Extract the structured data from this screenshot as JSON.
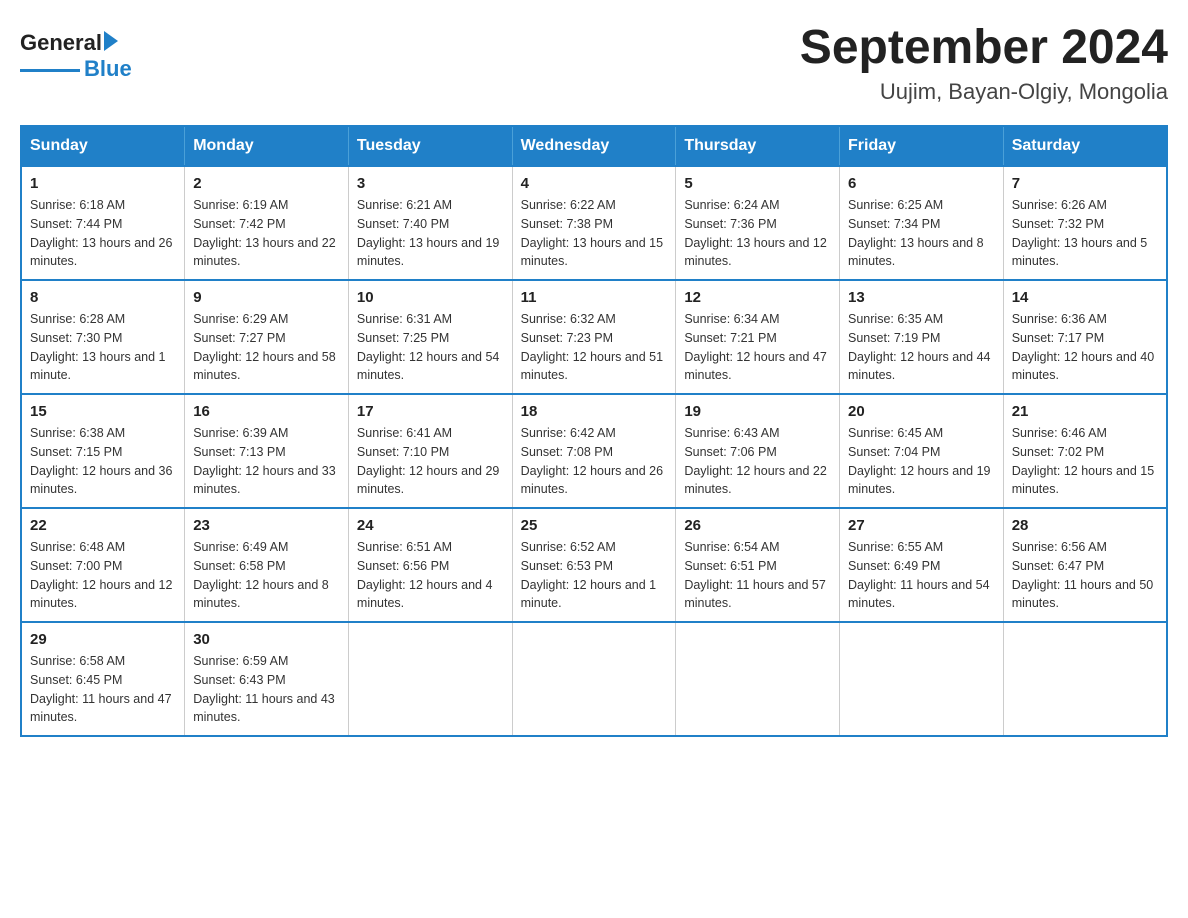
{
  "logo": {
    "general": "General",
    "blue": "Blue"
  },
  "header": {
    "title": "September 2024",
    "subtitle": "Uujim, Bayan-Olgiy, Mongolia"
  },
  "days_of_week": [
    "Sunday",
    "Monday",
    "Tuesday",
    "Wednesday",
    "Thursday",
    "Friday",
    "Saturday"
  ],
  "weeks": [
    [
      {
        "day": "1",
        "sunrise": "6:18 AM",
        "sunset": "7:44 PM",
        "daylight": "13 hours and 26 minutes."
      },
      {
        "day": "2",
        "sunrise": "6:19 AM",
        "sunset": "7:42 PM",
        "daylight": "13 hours and 22 minutes."
      },
      {
        "day": "3",
        "sunrise": "6:21 AM",
        "sunset": "7:40 PM",
        "daylight": "13 hours and 19 minutes."
      },
      {
        "day": "4",
        "sunrise": "6:22 AM",
        "sunset": "7:38 PM",
        "daylight": "13 hours and 15 minutes."
      },
      {
        "day": "5",
        "sunrise": "6:24 AM",
        "sunset": "7:36 PM",
        "daylight": "13 hours and 12 minutes."
      },
      {
        "day": "6",
        "sunrise": "6:25 AM",
        "sunset": "7:34 PM",
        "daylight": "13 hours and 8 minutes."
      },
      {
        "day": "7",
        "sunrise": "6:26 AM",
        "sunset": "7:32 PM",
        "daylight": "13 hours and 5 minutes."
      }
    ],
    [
      {
        "day": "8",
        "sunrise": "6:28 AM",
        "sunset": "7:30 PM",
        "daylight": "13 hours and 1 minute."
      },
      {
        "day": "9",
        "sunrise": "6:29 AM",
        "sunset": "7:27 PM",
        "daylight": "12 hours and 58 minutes."
      },
      {
        "day": "10",
        "sunrise": "6:31 AM",
        "sunset": "7:25 PM",
        "daylight": "12 hours and 54 minutes."
      },
      {
        "day": "11",
        "sunrise": "6:32 AM",
        "sunset": "7:23 PM",
        "daylight": "12 hours and 51 minutes."
      },
      {
        "day": "12",
        "sunrise": "6:34 AM",
        "sunset": "7:21 PM",
        "daylight": "12 hours and 47 minutes."
      },
      {
        "day": "13",
        "sunrise": "6:35 AM",
        "sunset": "7:19 PM",
        "daylight": "12 hours and 44 minutes."
      },
      {
        "day": "14",
        "sunrise": "6:36 AM",
        "sunset": "7:17 PM",
        "daylight": "12 hours and 40 minutes."
      }
    ],
    [
      {
        "day": "15",
        "sunrise": "6:38 AM",
        "sunset": "7:15 PM",
        "daylight": "12 hours and 36 minutes."
      },
      {
        "day": "16",
        "sunrise": "6:39 AM",
        "sunset": "7:13 PM",
        "daylight": "12 hours and 33 minutes."
      },
      {
        "day": "17",
        "sunrise": "6:41 AM",
        "sunset": "7:10 PM",
        "daylight": "12 hours and 29 minutes."
      },
      {
        "day": "18",
        "sunrise": "6:42 AM",
        "sunset": "7:08 PM",
        "daylight": "12 hours and 26 minutes."
      },
      {
        "day": "19",
        "sunrise": "6:43 AM",
        "sunset": "7:06 PM",
        "daylight": "12 hours and 22 minutes."
      },
      {
        "day": "20",
        "sunrise": "6:45 AM",
        "sunset": "7:04 PM",
        "daylight": "12 hours and 19 minutes."
      },
      {
        "day": "21",
        "sunrise": "6:46 AM",
        "sunset": "7:02 PM",
        "daylight": "12 hours and 15 minutes."
      }
    ],
    [
      {
        "day": "22",
        "sunrise": "6:48 AM",
        "sunset": "7:00 PM",
        "daylight": "12 hours and 12 minutes."
      },
      {
        "day": "23",
        "sunrise": "6:49 AM",
        "sunset": "6:58 PM",
        "daylight": "12 hours and 8 minutes."
      },
      {
        "day": "24",
        "sunrise": "6:51 AM",
        "sunset": "6:56 PM",
        "daylight": "12 hours and 4 minutes."
      },
      {
        "day": "25",
        "sunrise": "6:52 AM",
        "sunset": "6:53 PM",
        "daylight": "12 hours and 1 minute."
      },
      {
        "day": "26",
        "sunrise": "6:54 AM",
        "sunset": "6:51 PM",
        "daylight": "11 hours and 57 minutes."
      },
      {
        "day": "27",
        "sunrise": "6:55 AM",
        "sunset": "6:49 PM",
        "daylight": "11 hours and 54 minutes."
      },
      {
        "day": "28",
        "sunrise": "6:56 AM",
        "sunset": "6:47 PM",
        "daylight": "11 hours and 50 minutes."
      }
    ],
    [
      {
        "day": "29",
        "sunrise": "6:58 AM",
        "sunset": "6:45 PM",
        "daylight": "11 hours and 47 minutes."
      },
      {
        "day": "30",
        "sunrise": "6:59 AM",
        "sunset": "6:43 PM",
        "daylight": "11 hours and 43 minutes."
      },
      null,
      null,
      null,
      null,
      null
    ]
  ]
}
